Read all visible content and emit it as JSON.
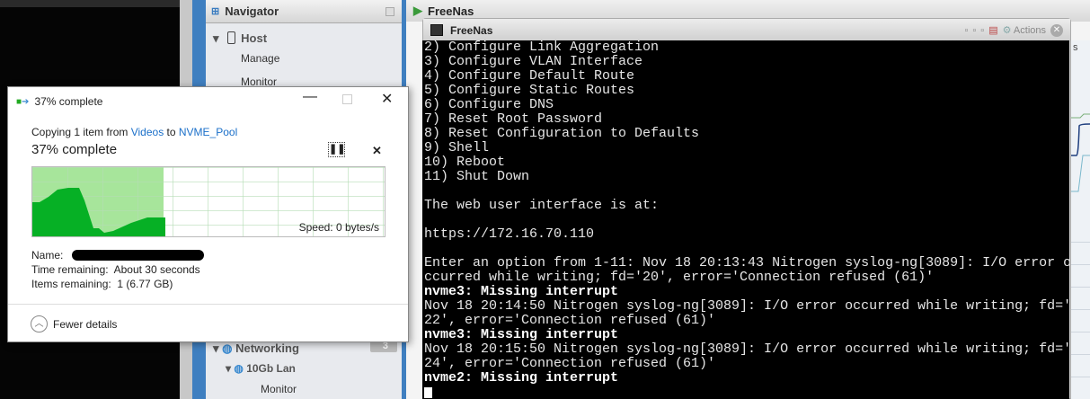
{
  "navigator": {
    "title": "Navigator",
    "items": [
      {
        "label": "Host"
      },
      {
        "label": "Manage"
      },
      {
        "label": "Monitor"
      },
      {
        "label": "Networking",
        "badge": "3"
      },
      {
        "label": "10Gb Lan"
      },
      {
        "label": "Monitor"
      }
    ]
  },
  "main": {
    "title": "FreeNas",
    "side_letter": "s"
  },
  "console": {
    "title": "FreeNas",
    "actions_label": "Actions",
    "lines": [
      {
        "t": "2) Configure Link Aggregation"
      },
      {
        "t": "3) Configure VLAN Interface"
      },
      {
        "t": "4) Configure Default Route"
      },
      {
        "t": "5) Configure Static Routes"
      },
      {
        "t": "6) Configure DNS"
      },
      {
        "t": "7) Reset Root Password"
      },
      {
        "t": "8) Reset Configuration to Defaults"
      },
      {
        "t": "9) Shell"
      },
      {
        "t": "10) Reboot"
      },
      {
        "t": "11) Shut Down"
      },
      {
        "t": ""
      },
      {
        "t": "The web user interface is at:"
      },
      {
        "t": ""
      },
      {
        "t": "https://172.16.70.110"
      },
      {
        "t": ""
      },
      {
        "t": "Enter an option from 1-11: Nov 18 20:13:43 Nitrogen syslog-ng[3089]: I/O error o"
      },
      {
        "t": "ccurred while writing; fd='20', error='Connection refused (61)'"
      },
      {
        "t": "nvme3: Missing interrupt",
        "bold": true
      },
      {
        "t": "Nov 18 20:14:50 Nitrogen syslog-ng[3089]: I/O error occurred while writing; fd='"
      },
      {
        "t": "22', error='Connection refused (61)'"
      },
      {
        "t": "nvme3: Missing interrupt",
        "bold": true
      },
      {
        "t": "Nov 18 20:15:50 Nitrogen syslog-ng[3089]: I/O error occurred while writing; fd='"
      },
      {
        "t": "24', error='Connection refused (61)'"
      },
      {
        "t": "nvme2: Missing interrupt",
        "bold": true
      }
    ]
  },
  "copy_dialog": {
    "title": "37% complete",
    "copying_prefix": "Copying 1 item from ",
    "source": "Videos",
    "to": " to ",
    "destination": "NVME_Pool",
    "heading": "37% complete",
    "progress": 0.37,
    "speed": "Speed: 0 bytes/s",
    "name_label": "Name:",
    "time_label": "Time remaining:",
    "time_value": "About 30 seconds",
    "items_label": "Items remaining:",
    "items_value": "1 (6.77 GB)",
    "fewer_details": "Fewer details",
    "accent": "#06b025"
  }
}
